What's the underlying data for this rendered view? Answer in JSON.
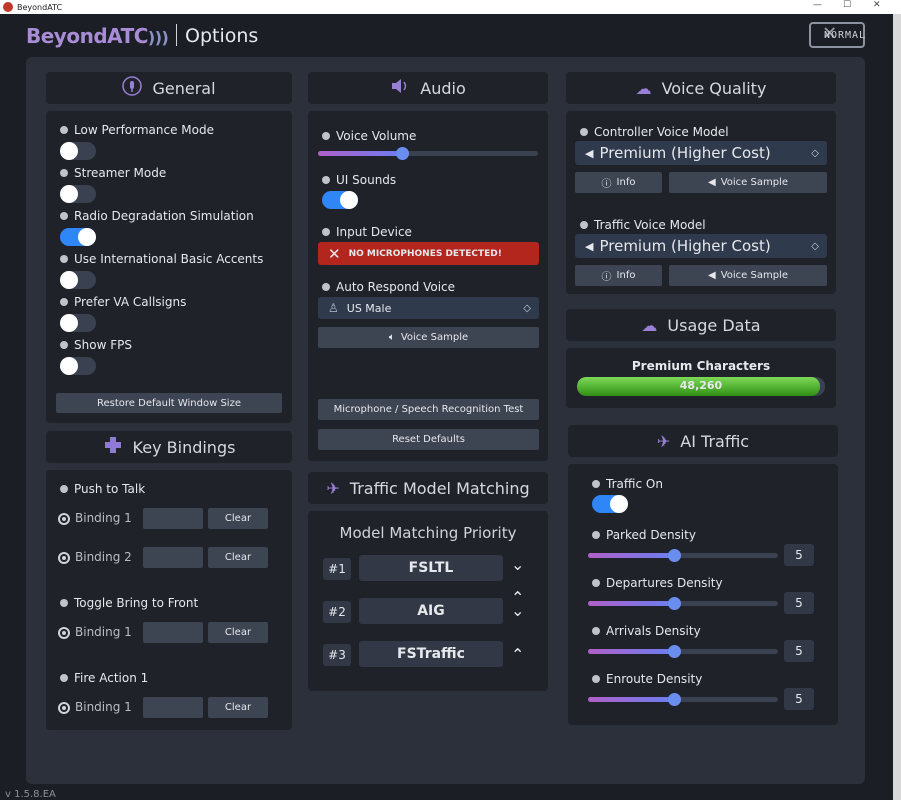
{
  "window": {
    "title": "BeyondATC",
    "minimize": "—",
    "maximize": "☐",
    "close": "✕"
  },
  "header": {
    "logo": "BeyondATC",
    "logo_suffix": ")))",
    "title": "Options",
    "normal_label": "NORMAL",
    "close_glyph": "✕"
  },
  "general": {
    "title": "General",
    "options": [
      {
        "label": "Low Performance Mode",
        "on": false
      },
      {
        "label": "Streamer Mode",
        "on": false
      },
      {
        "label": "Radio Degradation Simulation",
        "on": true
      },
      {
        "label": "Use International Basic Accents",
        "on": false
      },
      {
        "label": "Prefer VA Callsigns",
        "on": false
      },
      {
        "label": "Show FPS",
        "on": false
      }
    ],
    "restore_label": "Restore Default Window Size"
  },
  "audio": {
    "title": "Audio",
    "voice_volume_label": "Voice Volume",
    "voice_volume": 0.38,
    "ui_sounds_label": "UI Sounds",
    "ui_sounds_on": true,
    "input_device_label": "Input Device",
    "no_mic": "NO MICROPHONES DETECTED!",
    "auto_respond_label": "Auto Respond Voice",
    "auto_respond_value": "US Male",
    "voice_sample": "Voice Sample",
    "mic_test": "Microphone / Speech Recognition Test",
    "reset": "Reset Defaults"
  },
  "voice_quality": {
    "title": "Voice Quality",
    "controller_label": "Controller Voice Model",
    "controller_value": "Premium (Higher Cost)",
    "traffic_label": "Traffic Voice Model",
    "traffic_value": "Premium (Higher Cost)",
    "info": "Info",
    "voice_sample": "Voice Sample"
  },
  "usage": {
    "title": "Usage Data",
    "premium_label": "Premium Characters",
    "premium_value": "48,260",
    "fill_fraction": 0.98
  },
  "key_bindings": {
    "title": "Key Bindings",
    "groups": [
      {
        "name": "Push to Talk",
        "bindings": [
          "Binding 1",
          "Binding 2"
        ]
      },
      {
        "name": "Toggle Bring to Front",
        "bindings": [
          "Binding 1"
        ]
      },
      {
        "name": "Fire Action 1",
        "bindings": [
          "Binding 1"
        ]
      }
    ],
    "clear": "Clear"
  },
  "traffic_model": {
    "title": "Traffic Model Matching",
    "priority_title": "Model Matching Priority",
    "items": [
      {
        "rank": "#1",
        "name": "FSLTL"
      },
      {
        "rank": "#2",
        "name": "AIG"
      },
      {
        "rank": "#3",
        "name": "FSTraffic"
      }
    ]
  },
  "ai_traffic": {
    "title": "AI Traffic",
    "traffic_on_label": "Traffic On",
    "traffic_on": true,
    "densities": [
      {
        "label": "Parked Density",
        "value": "5",
        "fraction": 0.45
      },
      {
        "label": "Departures Density",
        "value": "5",
        "fraction": 0.45
      },
      {
        "label": "Arrivals Density",
        "value": "5",
        "fraction": 0.45
      },
      {
        "label": "Enroute Density",
        "value": "5",
        "fraction": 0.45
      }
    ]
  },
  "version": "v 1.5.8.EA",
  "colors": {
    "accent": "#2f86f6",
    "danger": "#b3261e",
    "usage_bar": "#3fb01a",
    "panel": "#1f2229",
    "bg": "#2c303a"
  }
}
